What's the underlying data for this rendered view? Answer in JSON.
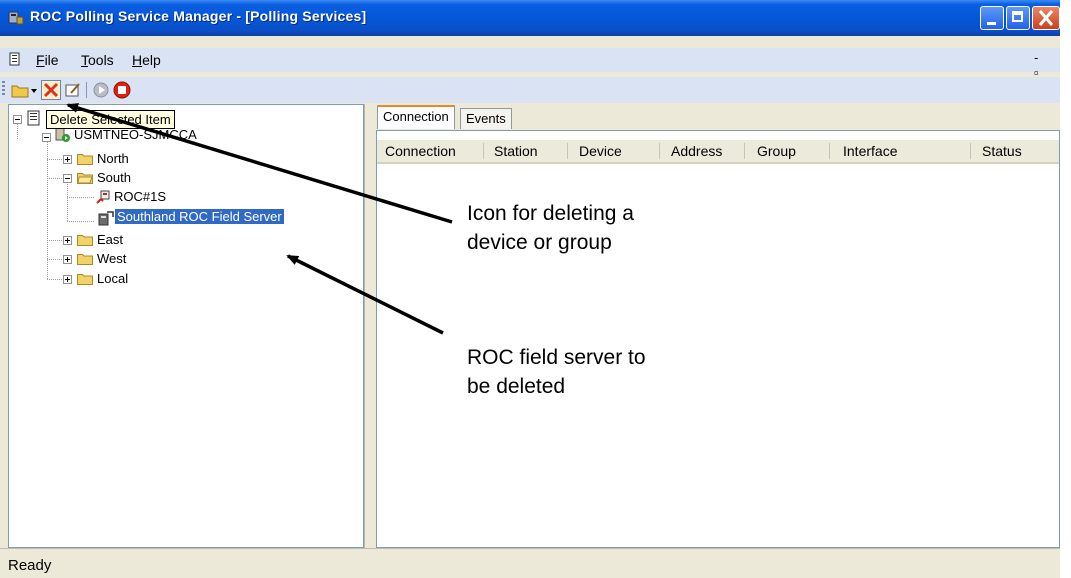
{
  "window": {
    "title": "ROC Polling Service Manager - [Polling Services]"
  },
  "menu": {
    "items": [
      {
        "label": "File",
        "underline": "F"
      },
      {
        "label": "Tools",
        "underline": "T"
      },
      {
        "label": "Help",
        "underline": "H"
      }
    ],
    "mdi_controls": "- ▫"
  },
  "toolbar": {
    "buttons": [
      {
        "icon": "open-folder-icon"
      },
      {
        "icon": "dropdown-arrow-icon"
      },
      {
        "icon": "delete-x-icon"
      },
      {
        "icon": "edit-properties-icon"
      },
      {
        "icon": "start-icon"
      },
      {
        "icon": "stop-icon"
      }
    ]
  },
  "tooltip": {
    "text": "Delete Selected Item"
  },
  "tree": {
    "root": {
      "label": "R"
    },
    "server": {
      "label": "USMTNEO-SJMCCA"
    },
    "groups": [
      {
        "label": "North"
      },
      {
        "label": "South"
      },
      {
        "label": "East"
      },
      {
        "label": "West"
      },
      {
        "label": "Local"
      }
    ],
    "south_children": [
      {
        "label": "ROC#1S"
      },
      {
        "label": "Southland ROC Field Server",
        "selected": true
      }
    ]
  },
  "tabs": [
    {
      "label": "Connection",
      "active": true
    },
    {
      "label": "Events",
      "active": false
    }
  ],
  "list": {
    "columns": [
      "Connection",
      "Station",
      "Device",
      "Address",
      "Group",
      "Interface",
      "Status"
    ],
    "rows": []
  },
  "status_bar": {
    "text": "Ready"
  },
  "annotations": [
    {
      "lines": [
        "Icon for deleting a",
        "device or group"
      ]
    },
    {
      "lines": [
        "ROC field server to",
        "be deleted"
      ]
    }
  ],
  "colors": {
    "titlebar": "#0457d8",
    "selection": "#316ac5",
    "delete_icon": "#e03020",
    "stop_icon": "#e02010",
    "tab_highlight": "#e68b2c"
  }
}
